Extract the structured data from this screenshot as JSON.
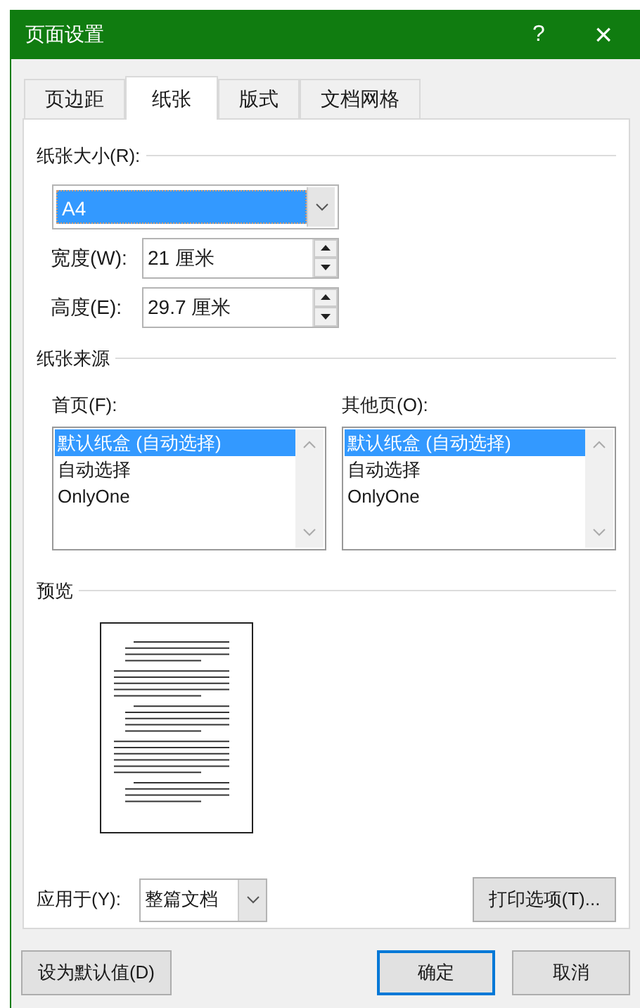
{
  "window": {
    "title": "页面设置",
    "help": "?",
    "close": "×"
  },
  "tabs": [
    {
      "label": "页边距",
      "selected": false
    },
    {
      "label": "纸张",
      "selected": true
    },
    {
      "label": "版式",
      "selected": false
    },
    {
      "label": "文档网格",
      "selected": false
    }
  ],
  "paper_size": {
    "heading": "纸张大小(R):",
    "value": "A4",
    "width_label": "宽度(W):",
    "width": "21 厘米",
    "height_label": "高度(E):",
    "height": "29.7 厘米"
  },
  "paper_source": {
    "heading": "纸张来源",
    "lists": [
      {
        "label": "首页(F):",
        "items": [
          {
            "text": "默认纸盒 (自动选择)",
            "selected": true
          },
          {
            "text": "自动选择",
            "selected": false
          },
          {
            "text": "OnlyOne",
            "selected": false
          }
        ]
      },
      {
        "label": "其他页(O):",
        "items": [
          {
            "text": "默认纸盒 (自动选择)",
            "selected": true
          },
          {
            "text": "自动选择",
            "selected": false
          },
          {
            "text": "OnlyOne",
            "selected": false
          }
        ]
      }
    ]
  },
  "preview": {
    "heading": "预览"
  },
  "apply_to": {
    "label": "应用于(Y):",
    "value": "整篇文档"
  },
  "print_options_button": "打印选项(T)...",
  "buttons": [
    {
      "label": "设为默认值(D)",
      "default": false
    },
    {
      "label": "确定",
      "default": true
    },
    {
      "label": "取消",
      "default": false
    }
  ]
}
